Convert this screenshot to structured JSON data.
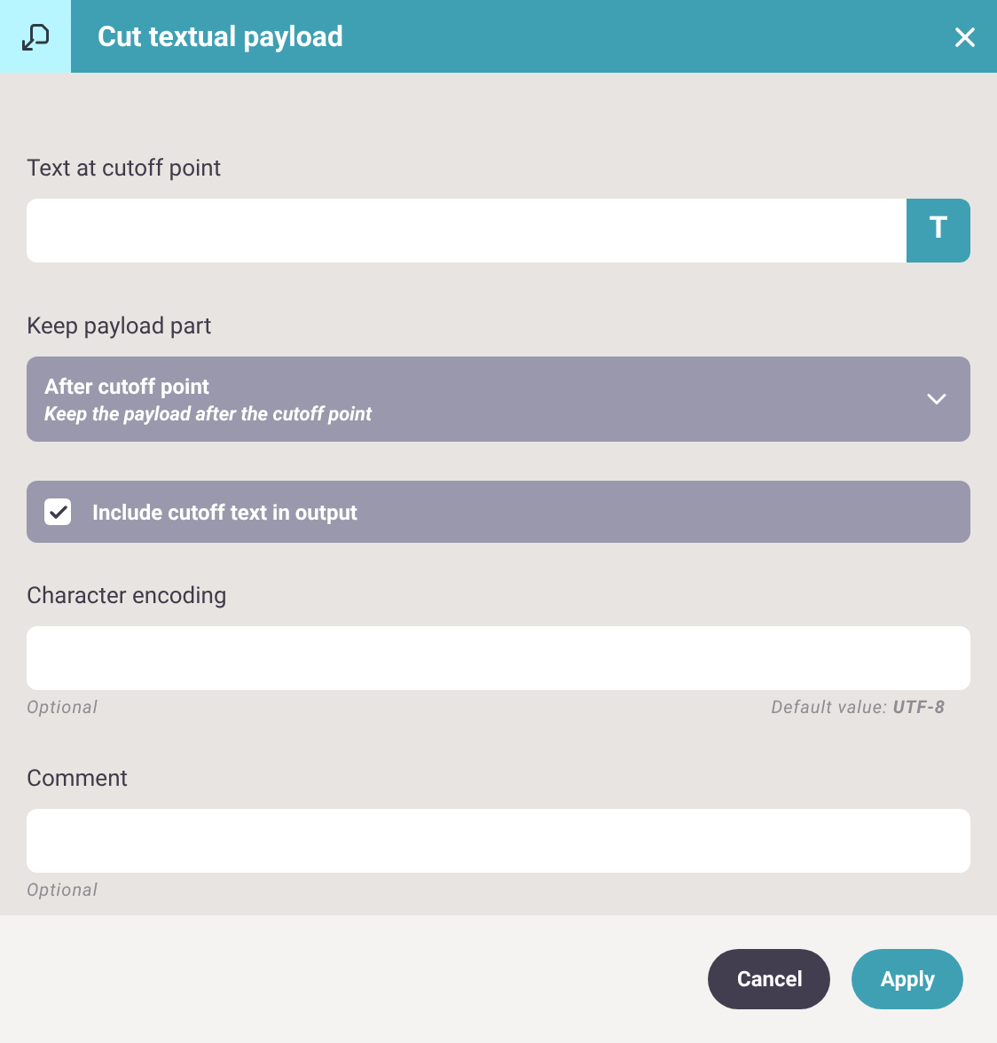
{
  "dialog": {
    "title": "Cut textual payload"
  },
  "fields": [
    {
      "kind": "text",
      "label": "Text at cutoff point",
      "button": "T"
    },
    {
      "kind": "select",
      "label": "Keep payload part",
      "value": "After cutoff point",
      "description": "Keep the payload after the cutoff point"
    },
    {
      "kind": "checkbox",
      "label": "Include cutoff text in output",
      "checked": true
    },
    {
      "kind": "text",
      "label": "Character encoding",
      "hint": "Optional",
      "default": "Default value: **UTF-8**"
    },
    {
      "kind": "text",
      "label": "Comment",
      "hint": "Optional"
    }
  ],
  "buttons": [
    {
      "kind": "secondary",
      "label": "Cancel"
    },
    {
      "kind": "primary",
      "label": "Apply"
    }
  ]
}
